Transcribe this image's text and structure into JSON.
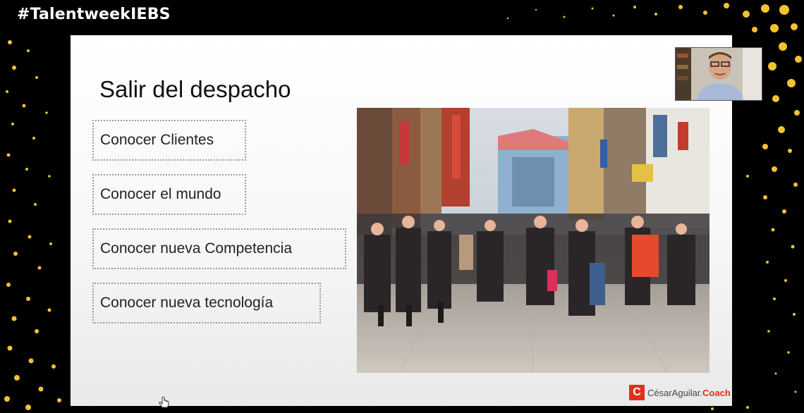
{
  "event": {
    "hashtag": "#TalentweekIEBS"
  },
  "slide": {
    "title": "Salir del despacho",
    "bullets": [
      "Conocer Clientes",
      "Conocer el mundo",
      "Conocer nueva Competencia",
      "Conocer nueva tecnología"
    ],
    "photo": {
      "subject": "busy pedestrian shopping street crowd"
    }
  },
  "branding": {
    "logo_letter": "C",
    "name": "CésarAguilar.",
    "suffix": "Coach",
    "accent_color": "#e0301e"
  },
  "webcam": {
    "subject": "presenter webcam feed"
  },
  "theme": {
    "background": "#000000",
    "dot_color": "#f2c230",
    "text_color": "#ffffff"
  }
}
